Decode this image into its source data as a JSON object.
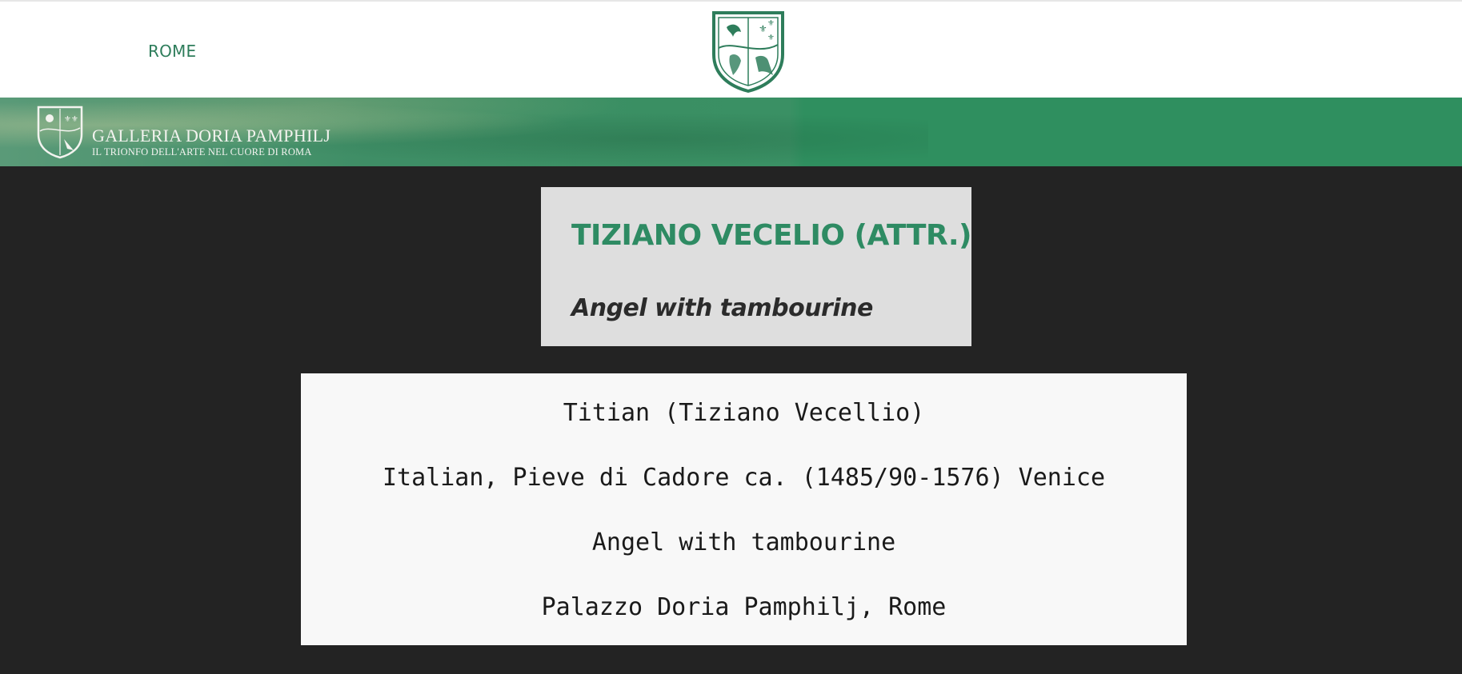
{
  "nav": {
    "city_link": "ROME"
  },
  "header": {
    "crest_icon": "coat-of-arms-icon",
    "brand_color": "#2e7d5b"
  },
  "banner": {
    "title": "GALLERIA DORIA PAMPHILJ",
    "subtitle": "IL TRIONFO DELL'ARTE NEL CUORE DI ROMA",
    "crest_icon": "coat-of-arms-icon"
  },
  "artwork": {
    "artist": "TIZIANO VECELIO (ATTR.)",
    "title": "Angel with tambourine"
  },
  "details": {
    "line1": "Titian (Tiziano Vecellio)",
    "line2": "Italian, Pieve di Cadore ca. (1485/90-1576) Venice",
    "line3": "Angel with tambourine",
    "line4": "Palazzo Doria Pamphilj, Rome"
  },
  "colors": {
    "accent": "#2e8b63",
    "page_background": "#232323",
    "banner_green": "#2f8f5f"
  }
}
